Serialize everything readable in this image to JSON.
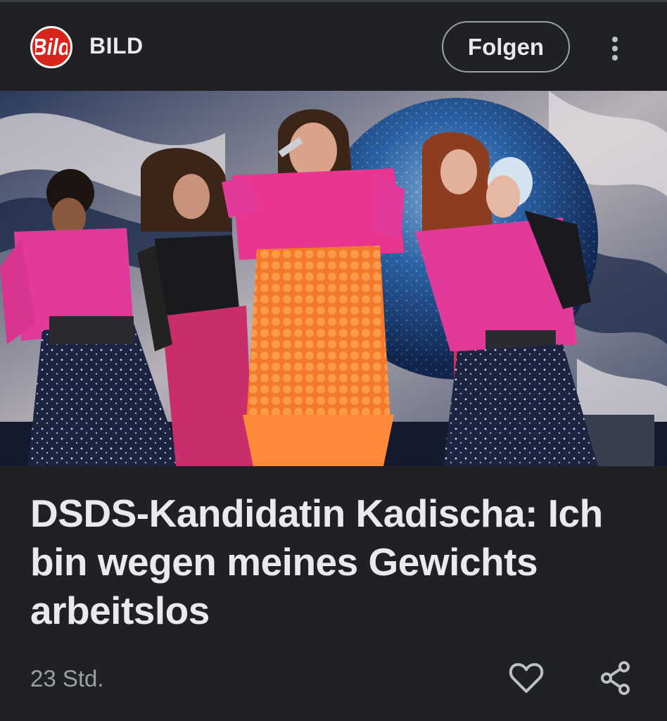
{
  "source": {
    "logo_text": "Bild",
    "name": "BILD"
  },
  "header": {
    "follow_label": "Folgen",
    "more_icon": "more-vert-icon"
  },
  "article": {
    "image_subject": "stage performance photo",
    "headline": "DSDS-Kandidatin Kadischa: Ich bin wegen meines Gewichts arbeitslos",
    "timestamp": "23 Std."
  },
  "actions": {
    "like_icon": "heart-icon",
    "share_icon": "share-icon"
  },
  "colors": {
    "background": "#202124",
    "logo_red": "#d8251b",
    "text": "#e8eaed",
    "muted": "#9aa0a6"
  }
}
